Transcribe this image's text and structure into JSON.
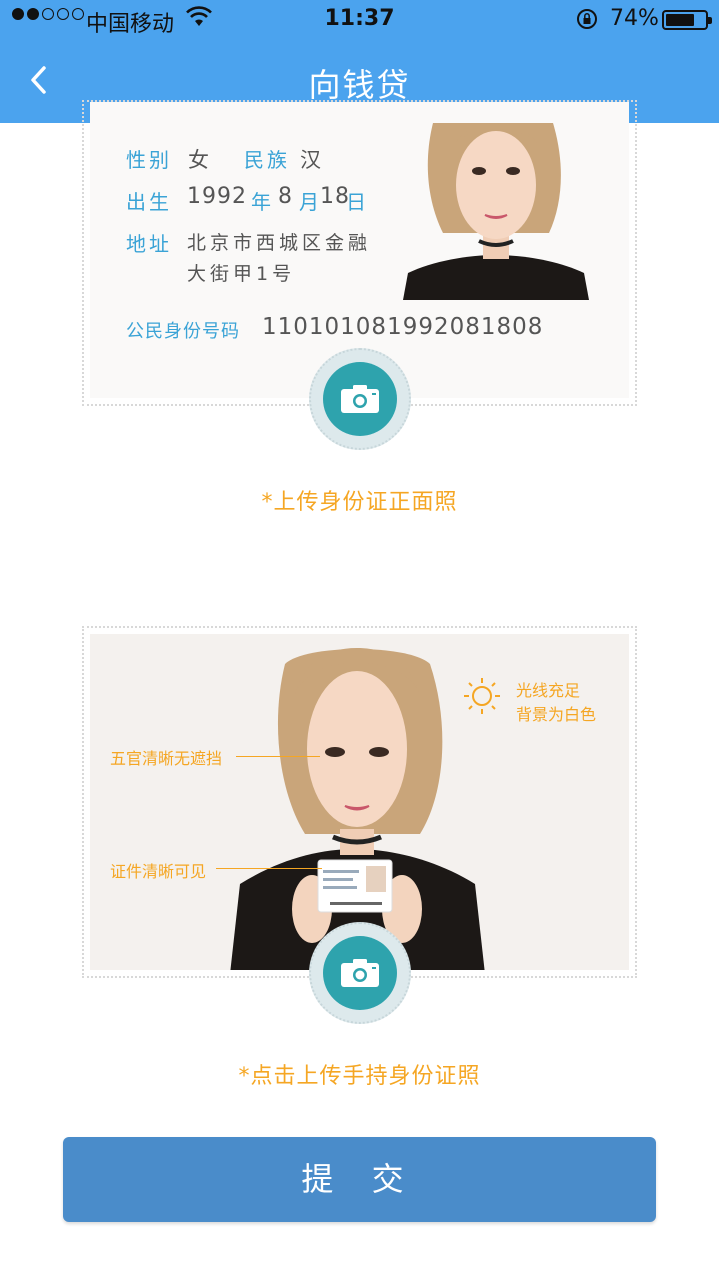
{
  "status_bar": {
    "carrier": "中国移动",
    "time": "11:37",
    "battery_percent": "74%",
    "battery_level": 0.74,
    "signal_bars": 2
  },
  "nav": {
    "title": "向钱贷",
    "back_icon": "chevron-left-icon"
  },
  "id_front": {
    "gender_label": "性别",
    "gender_value": "女",
    "ethnicity_label": "民族",
    "ethnicity_value": "汉",
    "birth_label": "出生",
    "birth_year": "1992",
    "year_char": "年",
    "birth_month": "8",
    "month_char": "月",
    "birth_day": "18",
    "day_char": "日",
    "address_label": "地址",
    "address_line1": "北京市西城区金融",
    "address_line2": "大街甲1号",
    "id_number_label": "公民身份号码",
    "id_number": "110101081992081808",
    "upload_hint": "*上传身份证正面照"
  },
  "handheld": {
    "tip_lighting_1": "光线充足",
    "tip_lighting_2": "背景为白色",
    "tip_face": "五官清晰无遮挡",
    "tip_card": "证件清晰可见",
    "upload_hint": "*点击上传手持身份证照"
  },
  "submit_label": "提 交",
  "colors": {
    "header": "#4ba3ee",
    "accent_orange": "#f5a623",
    "label_blue": "#3aa3d6",
    "camera_teal": "#2ea3ad",
    "submit_blue": "#4a8cca"
  }
}
